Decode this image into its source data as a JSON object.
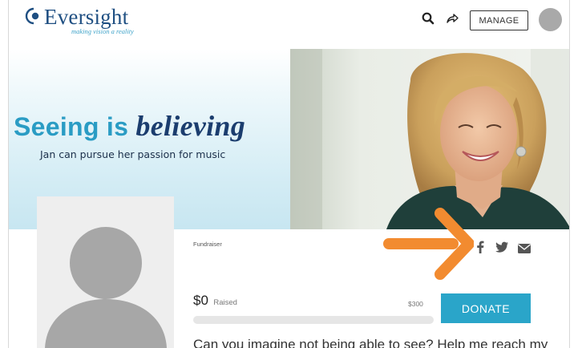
{
  "brand": {
    "name": "Eversight",
    "tagline": "making vision a reality",
    "color": "#1f4f82",
    "accent": "#2aa5c9"
  },
  "header": {
    "icons": [
      "search-icon",
      "share-icon"
    ],
    "manage_label": "MANAGE"
  },
  "banner": {
    "headline_part1": "Seeing is ",
    "headline_part2": "believing",
    "subline": "Jan can pursue her passion for music"
  },
  "fundraiser": {
    "type_label": "Fundraiser",
    "raised_amount": "$0",
    "raised_label": "Raised",
    "goal": "$300",
    "progress_fraction": 0,
    "donate_label": "DONATE",
    "story_preview": "Can you imagine not being able to see? Help me reach my"
  },
  "social": {
    "icons": [
      "facebook-icon",
      "twitter-icon",
      "mail-icon"
    ]
  },
  "annotation": {
    "arrow_color": "#f28b30"
  }
}
